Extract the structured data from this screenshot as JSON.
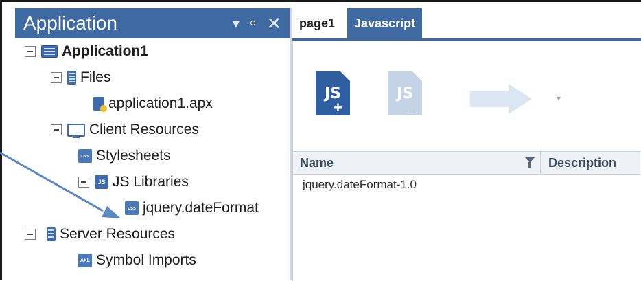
{
  "app_panel": {
    "title": "Application",
    "header_buttons": {
      "dropdown": "▾",
      "pin": "⌖",
      "close": "✕"
    }
  },
  "tree": {
    "root": "Application1",
    "files_folder": "Files",
    "app_file": "application1.apx",
    "client_resources": "Client Resources",
    "stylesheets": "Stylesheets",
    "js_libraries": "JS Libraries",
    "js_library_item": "jquery.dateFormat",
    "server_resources": "Server Resources",
    "symbol_imports": "Symbol Imports"
  },
  "icon_text": {
    "css": "css",
    "js": "JS",
    "axl": "AXL"
  },
  "tabs": [
    "page1",
    "Javascript"
  ],
  "toolbar": {
    "add_js_text": "JS",
    "remove_js_text": "JS",
    "dropdown_caret": "▾"
  },
  "grid": {
    "columns": [
      "Name",
      "Description"
    ],
    "rows": [
      {
        "name": "jquery.dateFormat-1.0"
      }
    ]
  },
  "colors": {
    "accent": "#3e6aa1",
    "callout_arrow": "#5b88c7"
  }
}
